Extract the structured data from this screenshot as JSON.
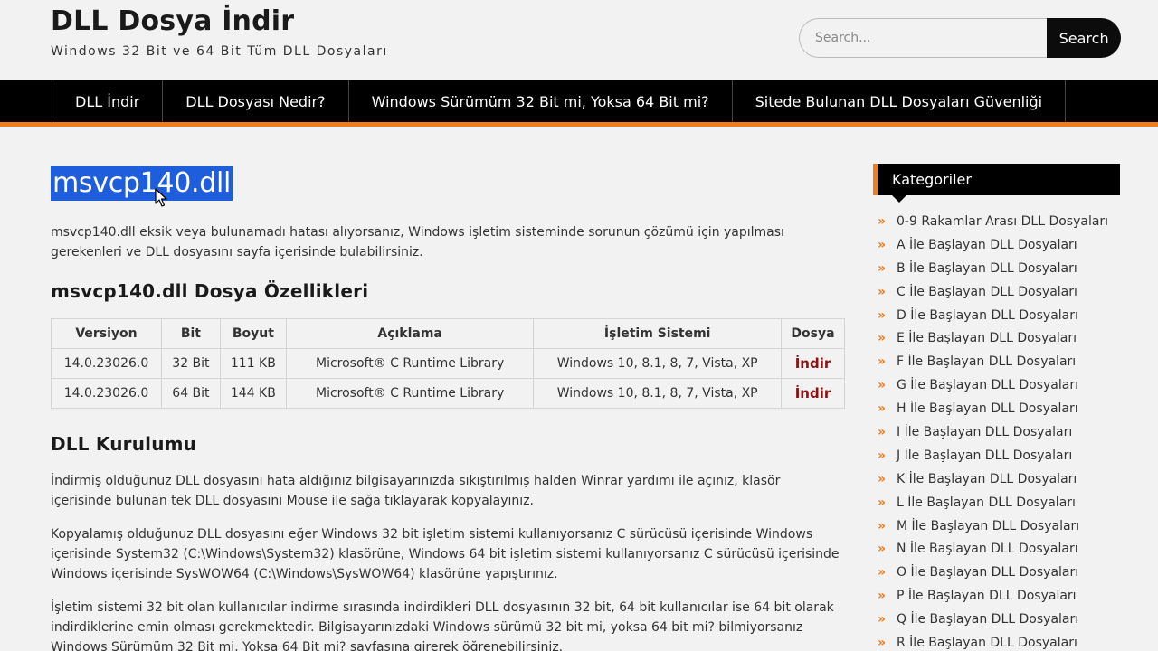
{
  "header": {
    "site_title": "DLL Dosya İndir",
    "tagline": "Windows 32 Bit ve 64 Bit Tüm DLL Dosyaları",
    "search_placeholder": "Search...",
    "search_button": "Search"
  },
  "nav": {
    "items": [
      {
        "label": "DLL İndir"
      },
      {
        "label": "DLL Dosyası Nedir?"
      },
      {
        "label": "Windows Sürümüm 32 Bit mi, Yoksa 64 Bit mi?"
      },
      {
        "label": "Sitede Bulunan DLL Dosyaları Güvenliği"
      }
    ]
  },
  "post": {
    "title": "msvcp140.dll",
    "intro": "msvcp140.dll eksik veya bulunamadı hatası alıyorsanız, Windows işletim sisteminde sorunun çözümü için yapılması gerekenleri ve DLL dosyasını sayfa içerisinde bulabilirsiniz.",
    "props_heading": "msvcp140.dll Dosya Özellikleri",
    "table": {
      "headers": [
        "Versiyon",
        "Bit",
        "Boyut",
        "Açıklama",
        "İşletim Sistemi",
        "Dosya"
      ],
      "rows": [
        [
          "14.0.23026.0",
          "32 Bit",
          "111 KB",
          "Microsoft® C Runtime Library",
          "Windows 10, 8.1, 8, 7, Vista, XP",
          "İndir"
        ],
        [
          "14.0.23026.0",
          "64 Bit",
          "144 KB",
          "Microsoft® C Runtime Library",
          "Windows 10, 8.1, 8, 7, Vista, XP",
          "İndir"
        ]
      ]
    },
    "install_heading": "DLL Kurulumu",
    "install_p1": "İndirmiş olduğunuz DLL dosyasını hata aldığınız bilgisayarınızda sıkıştırılmış halden Winrar yardımı ile açınız, klasör içerisinde bulunan tek DLL dosyasını Mouse ile sağa tıklayarak kopyalayınız.",
    "install_p2": "Kopyalamış olduğunuz DLL dosyasını eğer Windows 32 bit işletim sistemi kullanıyorsanız C sürücüsü içerisinde Windows içerisinde System32 (C:\\Windows\\System32) klasörüne, Windows 64 bit işletim sistemi kullanıyorsanız C sürücüsü içerisinde Windows içerisinde SysWOW64 (C:\\Windows\\SysWOW64) klasörüne yapıştırınız.",
    "install_p3": "İşletim sistemi 32 bit olan kullanıcılar indirme sırasında indirdikleri DLL dosyasının 32 bit, 64 bit kullanıcılar ise 64 bit olarak indirdiklerine emin olması gerekmektedir. Bilgisayarınızdaki Windows sürümü 32 bit mi, yoksa 64 bit mi? bilmiyorsanız Windows Sürümüm 32 Bit mi, Yoksa 64 Bit mi? sayfasına girerek öğrenebilirsiniz."
  },
  "sidebar": {
    "widget_title": "Kategoriler",
    "arrow_glyph": "»",
    "categories": [
      "0-9 Rakamlar Arası DLL Dosyaları",
      "A İle Başlayan DLL Dosyaları",
      "B İle Başlayan DLL Dosyaları",
      "C İle Başlayan DLL Dosyaları",
      "D İle Başlayan DLL Dosyaları",
      "E İle Başlayan DLL Dosyaları",
      "F İle Başlayan DLL Dosyaları",
      "G İle Başlayan DLL Dosyaları",
      "H İle Başlayan DLL Dosyaları",
      "I İle Başlayan DLL Dosyaları",
      "J İle Başlayan DLL Dosyaları",
      "K İle Başlayan DLL Dosyaları",
      "L İle Başlayan DLL Dosyaları",
      "M İle Başlayan DLL Dosyaları",
      "N İle Başlayan DLL Dosyaları",
      "O İle Başlayan DLL Dosyaları",
      "P İle Başlayan DLL Dosyaları",
      "Q İle Başlayan DLL Dosyaları",
      "R İle Başlayan DLL Dosyaları"
    ]
  },
  "colors": {
    "accent": "#f27c1c",
    "nav_bg": "#000000",
    "selection": "#1e5ddb",
    "download_link": "#8b1010"
  }
}
